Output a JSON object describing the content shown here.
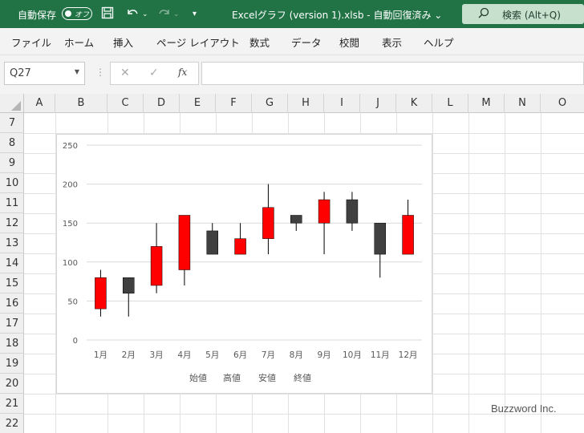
{
  "titlebar": {
    "autosave_label": "自動保存",
    "autosave_state": "オフ",
    "doc_title": "Excelグラフ (version 1).xlsb  -  自動回復済み  ⌄",
    "search_label": "検索 (Alt+Q)"
  },
  "ribbon": {
    "tabs": [
      "ファイル",
      "ホーム",
      "挿入",
      "ページ レイアウト",
      "数式",
      "データ",
      "校閲",
      "表示",
      "ヘルプ"
    ]
  },
  "formula_bar": {
    "name_box": "Q27",
    "formula": ""
  },
  "grid": {
    "columns": [
      "A",
      "B",
      "C",
      "D",
      "E",
      "F",
      "G",
      "H",
      "I",
      "J",
      "K",
      "L",
      "M",
      "N",
      "O"
    ],
    "rows": [
      "7",
      "8",
      "9",
      "10",
      "11",
      "12",
      "13",
      "14",
      "15",
      "16",
      "17",
      "18",
      "19",
      "20",
      "21",
      "22"
    ]
  },
  "chart_data": {
    "type": "candlestick",
    "categories": [
      "1月",
      "2月",
      "3月",
      "4月",
      "5月",
      "6月",
      "7月",
      "8月",
      "9月",
      "10月",
      "11月",
      "12月"
    ],
    "open": [
      40,
      80,
      70,
      90,
      140,
      110,
      130,
      160,
      150,
      180,
      150,
      110
    ],
    "high": [
      90,
      80,
      150,
      160,
      150,
      150,
      200,
      160,
      190,
      190,
      150,
      180
    ],
    "low": [
      30,
      30,
      60,
      70,
      110,
      110,
      110,
      140,
      110,
      140,
      80,
      110
    ],
    "close": [
      80,
      60,
      120,
      160,
      110,
      130,
      170,
      150,
      180,
      150,
      110,
      160
    ],
    "ylim": [
      0,
      250
    ],
    "yticks": [
      0,
      50,
      100,
      150,
      200,
      250
    ],
    "legend": [
      "始値",
      "高値",
      "安値",
      "終値"
    ],
    "legend_position": "bottom",
    "colors": {
      "up": "#ff0000",
      "down": "#404040",
      "wick": "#000000",
      "grid": "#d9d9d9"
    },
    "gridlines": true
  },
  "watermark": "Buzzword Inc.",
  "icons": {
    "save": "save-icon",
    "undo": "undo-icon",
    "redo": "redo-icon",
    "search": "search-icon"
  }
}
